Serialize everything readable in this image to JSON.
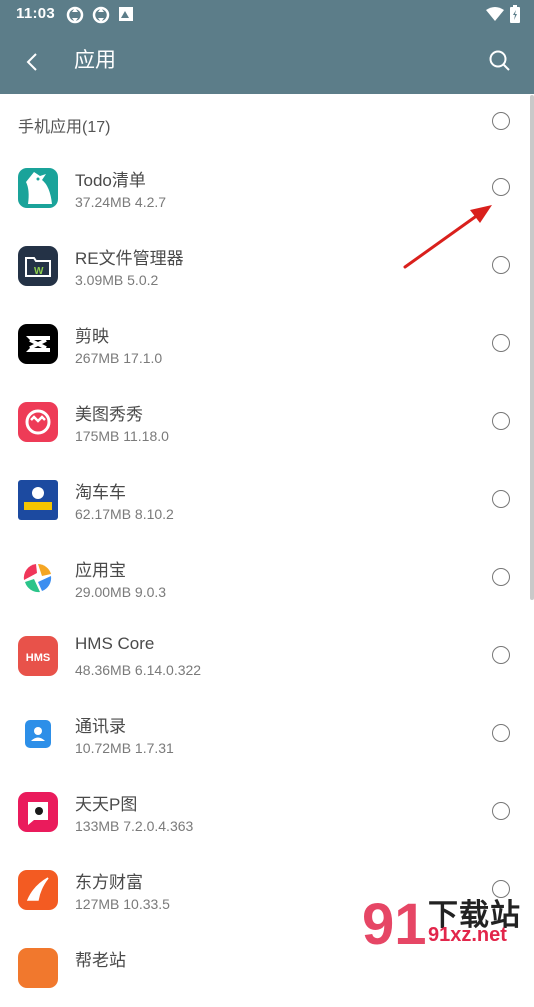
{
  "status": {
    "time": "11:03"
  },
  "header": {
    "title": "应用"
  },
  "section": {
    "label": "手机应用(17)"
  },
  "apps": [
    {
      "name": "Todo清单",
      "meta": "37.24MB 4.2.7",
      "icon": "todo-icon",
      "color": "#1aa39a"
    },
    {
      "name": "RE文件管理器",
      "meta": "3.09MB 5.0.2",
      "icon": "re-file-manager-icon",
      "color": "#243246"
    },
    {
      "name": "剪映",
      "meta": "267MB 17.1.0",
      "icon": "capcut-icon",
      "color": "#000000"
    },
    {
      "name": "美图秀秀",
      "meta": "175MB 11.18.0",
      "icon": "meitu-icon",
      "color": "#ee3b57"
    },
    {
      "name": "淘车车",
      "meta": "62.17MB 8.10.2",
      "icon": "taochechu-icon",
      "color": "#1c4aa0"
    },
    {
      "name": "应用宝",
      "meta": "29.00MB 9.0.3",
      "icon": "yingyongbao-icon",
      "color": "#ffffff"
    },
    {
      "name": "HMS Core",
      "meta": "48.36MB 6.14.0.322",
      "icon": "hms-core-icon",
      "color": "#e8524a"
    },
    {
      "name": "通讯录",
      "meta": "10.72MB 1.7.31",
      "icon": "contacts-icon",
      "color": "#2d8fe8"
    },
    {
      "name": "天天P图",
      "meta": "133MB 7.2.0.4.363",
      "icon": "tiantian-ptu-icon",
      "color": "#ea1b5c"
    },
    {
      "name": "东方财富",
      "meta": "127MB 10.33.5",
      "icon": "eastmoney-icon",
      "color": "#f35b22"
    },
    {
      "name": "帮老站",
      "meta": "",
      "icon": "partial-app-icon",
      "color": "#f1782d"
    }
  ],
  "watermark": {
    "text1": "下载站",
    "text2": "91xz.net"
  },
  "colors": {
    "header": "#5c7d89",
    "arrow": "#d9201c"
  }
}
